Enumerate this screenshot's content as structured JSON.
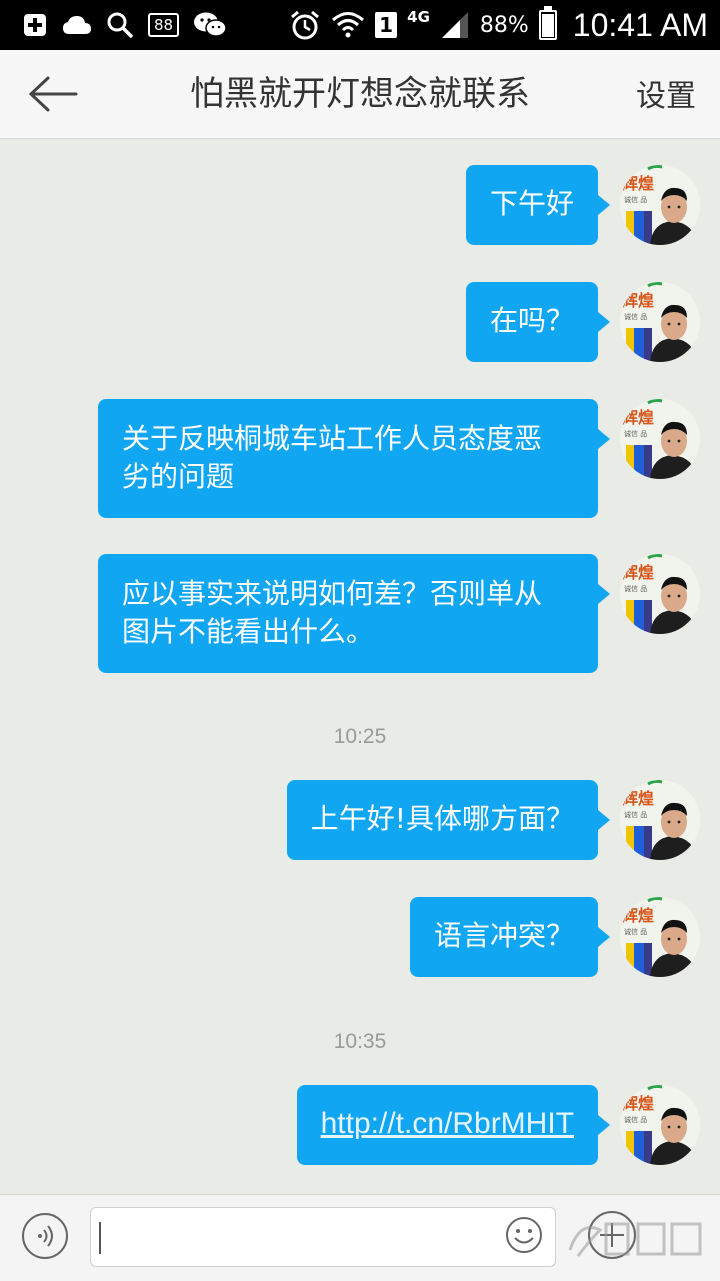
{
  "status_bar": {
    "notification_count": "88",
    "sim_slot": "1",
    "network": "4G",
    "battery_percent": "88%",
    "battery_level": 0.88,
    "time": "10:41 AM",
    "icons": [
      "add-box-icon",
      "cloud-icon",
      "search-icon",
      "badge-88-icon",
      "wechat-icon",
      "alarm-icon",
      "wifi-icon",
      "sim-icon",
      "signal-icon",
      "battery-icon"
    ]
  },
  "header": {
    "title": "怕黑就开灯想念就联系",
    "settings_label": "设置",
    "back_icon": "back-arrow-icon"
  },
  "messages": [
    {
      "text": "下午好"
    },
    {
      "text": "在吗？"
    },
    {
      "line1": "关于反映桐城车站工作人员态度恶",
      "line2": "劣的问题"
    },
    {
      "line1": "应以事实来说明如何差？否则单从",
      "line2": "图片不能看出什么。"
    },
    {
      "text": "上午好!具体哪方面？"
    },
    {
      "text": "语言冲突？"
    },
    {
      "text": "http://t.cn/RbrMHIT",
      "is_link": true
    }
  ],
  "timestamps": [
    "10:25",
    "10:35"
  ],
  "avatar": {
    "logo_text": "辉煌",
    "logo_sub": "诚信 品"
  },
  "input_bar": {
    "value": "",
    "icons": [
      "voice-icon",
      "emoji-icon",
      "plus-icon"
    ]
  },
  "colors": {
    "bubble": "#11a6f2",
    "background": "#e8ebe6",
    "header": "#f7f7f7"
  }
}
